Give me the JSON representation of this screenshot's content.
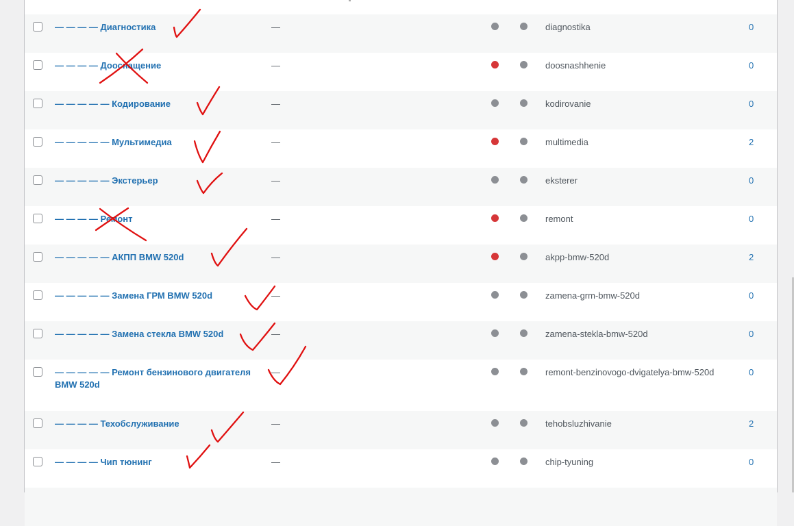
{
  "rows": [
    {
      "dashes": "— — — —",
      "label": "Диагностика",
      "description": "—",
      "slug": "diagnostika",
      "count": "0",
      "status1": "#8c8f94",
      "status2": "#8c8f94"
    },
    {
      "dashes": "— — — —",
      "label": "Дооснащение",
      "description": "—",
      "slug": "doosnashhenie",
      "count": "0",
      "status1": "#d63638",
      "status2": "#8c8f94"
    },
    {
      "dashes": "— — — — —",
      "label": "Кодирование",
      "description": "—",
      "slug": "kodirovanie",
      "count": "0",
      "status1": "#8c8f94",
      "status2": "#8c8f94"
    },
    {
      "dashes": "— — — — —",
      "label": "Мультимедиа",
      "description": "—",
      "slug": "multimedia",
      "count": "2",
      "status1": "#d63638",
      "status2": "#8c8f94"
    },
    {
      "dashes": "— — — — —",
      "label": "Экстерьер",
      "description": "—",
      "slug": "eksterer",
      "count": "0",
      "status1": "#8c8f94",
      "status2": "#8c8f94"
    },
    {
      "dashes": "— — — —",
      "label": "Ремонт",
      "description": "—",
      "slug": "remont",
      "count": "0",
      "status1": "#d63638",
      "status2": "#8c8f94"
    },
    {
      "dashes": "— — — — —",
      "label": "АКПП BMW 520d",
      "description": "—",
      "slug": "akpp-bmw-520d",
      "count": "2",
      "status1": "#d63638",
      "status2": "#8c8f94"
    },
    {
      "dashes": "— — — — —",
      "label": "Замена ГРМ BMW 520d",
      "description": "—",
      "slug": "zamena-grm-bmw-520d",
      "count": "0",
      "status1": "#8c8f94",
      "status2": "#8c8f94"
    },
    {
      "dashes": "— — — — —",
      "label": "Замена стекла BMW 520d",
      "description": "—",
      "slug": "zamena-stekla-bmw-520d",
      "count": "0",
      "status1": "#8c8f94",
      "status2": "#8c8f94"
    },
    {
      "dashes": "— — — — —",
      "label": "Ремонт бензинового двигателя BMW 520d",
      "description": "—",
      "slug": "remont-benzinovogo-dvigatelya-bmw-520d",
      "count": "0",
      "status1": "#8c8f94",
      "status2": "#8c8f94"
    },
    {
      "dashes": "— — — —",
      "label": "Техобслуживание",
      "description": "—",
      "slug": "tehobsluzhivanie",
      "count": "2",
      "status1": "#8c8f94",
      "status2": "#8c8f94"
    },
    {
      "dashes": "— — — —",
      "label": "Чип тюнинг",
      "description": "—",
      "slug": "chip-tyuning",
      "count": "0",
      "status1": "#8c8f94",
      "status2": "#8c8f94"
    }
  ],
  "annotation_color": "#e01010"
}
